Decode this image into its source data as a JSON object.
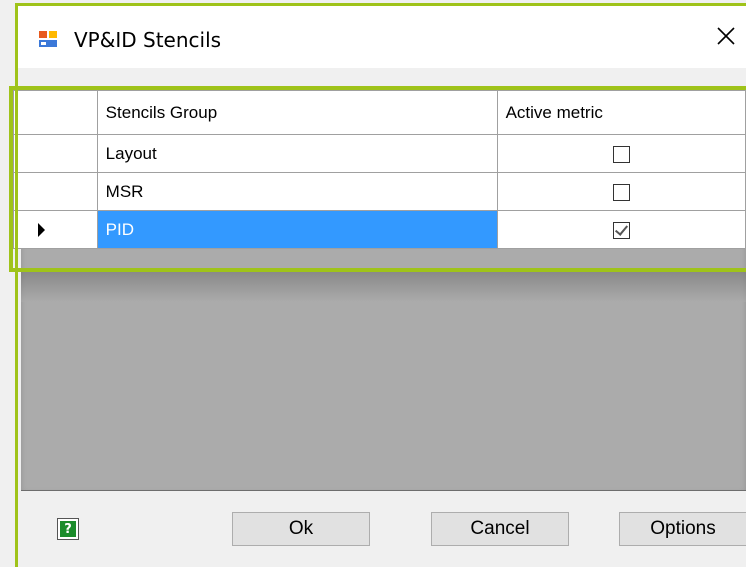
{
  "window": {
    "title": "VP&ID Stencils",
    "app_icon": "stencils-app-icon",
    "close_icon": "close-icon"
  },
  "grid": {
    "columns": [
      "Stencils Group",
      "Active metric"
    ],
    "rows": [
      {
        "group": "Layout",
        "active": false,
        "selected": false
      },
      {
        "group": "MSR",
        "active": false,
        "selected": false
      },
      {
        "group": "PID",
        "active": true,
        "selected": true
      }
    ]
  },
  "footer": {
    "help_icon": "help-icon",
    "ok_label": "Ok",
    "cancel_label": "Cancel",
    "options_label": "Options"
  },
  "colors": {
    "highlight": "#9fc31a",
    "selection": "#3399ff"
  }
}
